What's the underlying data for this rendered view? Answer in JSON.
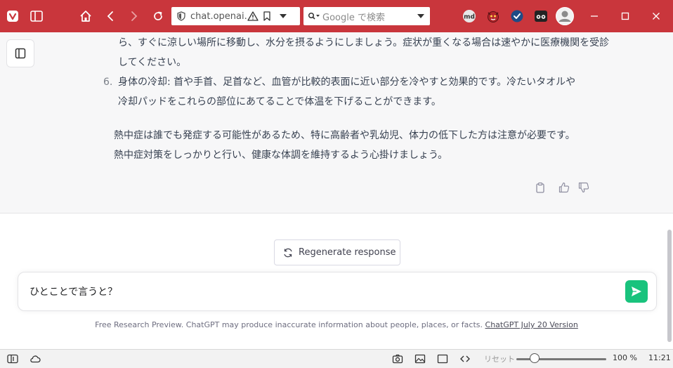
{
  "browser": {
    "url": "chat.openai.c",
    "search_placeholder": "Google で検索",
    "extensions": [
      "md-extension-icon",
      "monster-extension-icon",
      "check-shield-extension-icon",
      "game-extension-icon"
    ],
    "accent_color": "#c9363c"
  },
  "chat": {
    "lines": [
      "ら、すぐに涼しい場所に移動し、水分を摂るようにしましょう。症状が重くなる場合は速やかに医療機関を受診",
      "してください。"
    ],
    "item6": {
      "number": "6.",
      "line1": "身体の冷却: 首や手首、足首など、血管が比較的表面に近い部分を冷やすと効果的です。冷たいタオルや",
      "line2": "冷却パッドをこれらの部位にあてることで体温を下げることができます。"
    },
    "paragraph": [
      "熱中症は誰でも発症する可能性があるため、特に高齢者や乳幼児、体力の低下した方は注意が必要です。",
      "熱中症対策をしっかりと行い、健康な体調を維持するよう心掛けましょう。"
    ]
  },
  "regenerate_label": "Regenerate response",
  "input_value": "ひとことで言うと？",
  "send_color": "#19c37d",
  "footer": {
    "note": "Free Research Preview. ChatGPT may produce inaccurate information about people, places, or facts. ",
    "link": "ChatGPT July 20 Version"
  },
  "statusbar": {
    "reset_label": "リセット",
    "zoom_level": "100 %",
    "zoom_fraction": 0.2,
    "time": "11:21"
  }
}
